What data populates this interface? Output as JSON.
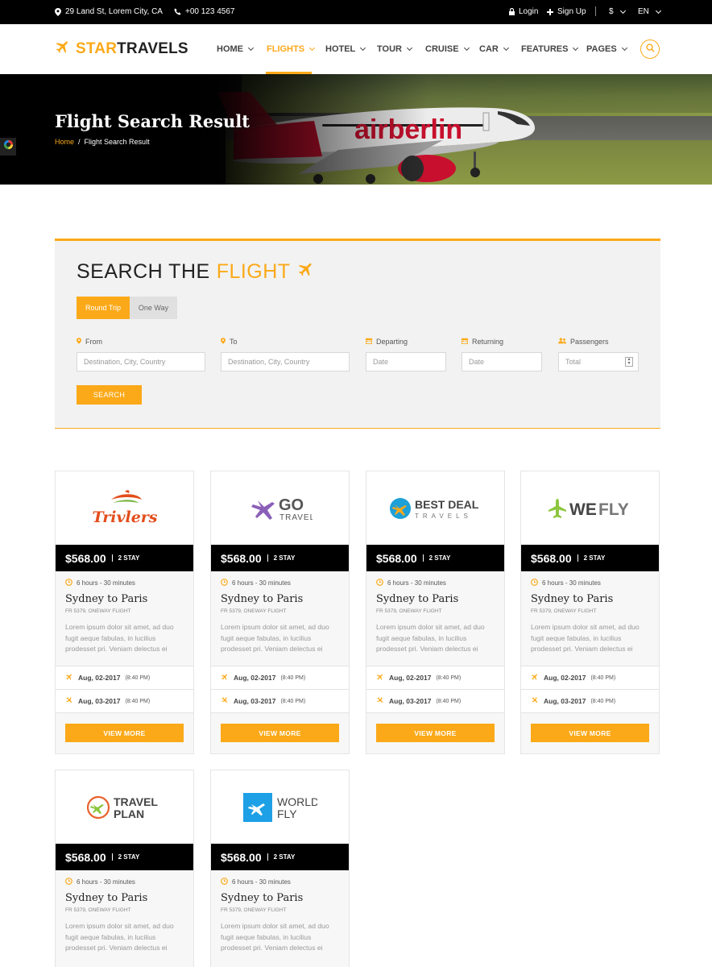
{
  "colors": {
    "accent": "#fba919",
    "dark": "#000000",
    "panel": "#f2f2f2"
  },
  "topbar": {
    "address": "29 Land St, Lorem City, CA",
    "phone": "+00 123 4567",
    "login": "Login",
    "signup": "Sign Up",
    "currency": "$",
    "language": "EN"
  },
  "header": {
    "logo_accent": "STAR",
    "logo_rest": "TRAVELS",
    "nav": [
      "HOME",
      "FLIGHTS",
      "HOTEL",
      "TOUR",
      "CRUISE",
      "CAR",
      "FEATURES",
      "PAGES"
    ],
    "active_nav": "FLIGHTS"
  },
  "hero": {
    "title": "Flight Search Result",
    "breadcrumb_home": "Home",
    "breadcrumb_current": "Flight Search Result",
    "livery_text": "airberlin"
  },
  "search": {
    "title_prefix": "SEARCH THE",
    "title_highlight": "FLIGHT",
    "tabs": [
      "Round Trip",
      "One Way"
    ],
    "active_tab": "Round Trip",
    "fields": [
      {
        "label": "From",
        "placeholder": "Destination, City, Country",
        "icon": "map-pin-icon"
      },
      {
        "label": "To",
        "placeholder": "Destination, City, Country",
        "icon": "map-pin-icon"
      },
      {
        "label": "Departing",
        "placeholder": "Date",
        "icon": "calendar-icon"
      },
      {
        "label": "Returning",
        "placeholder": "Date",
        "icon": "calendar-icon"
      },
      {
        "label": "Passengers",
        "placeholder": "Total",
        "icon": "users-icon"
      }
    ],
    "button": "SEARCH"
  },
  "flights": [
    {
      "brand": "Trivlers",
      "brand_line1": "Trivlers",
      "brand_line2": "",
      "price": "$568.00",
      "stay": "2 STAY",
      "duration": "6 hours - 30 minutes",
      "route": "Sydney to Paris",
      "flight_no": "FR 5379, ONEWAY FLIGHT",
      "description": "Lorem ipsum dolor sit amet, ad duo fugit aeque fabulas, in lucilius prodesset pri. Veniam delectus ei",
      "depart_date": "Aug, 02-2017",
      "depart_time": "(8:40 PM)",
      "arrive_date": "Aug, 03-2017",
      "arrive_time": "(8:40 PM)",
      "button": "VIEW MORE"
    },
    {
      "brand": "GO TRAVEL",
      "brand_line1": "GO",
      "brand_line2": "TRAVEL",
      "price": "$568.00",
      "stay": "2 STAY",
      "duration": "6 hours - 30 minutes",
      "route": "Sydney to Paris",
      "flight_no": "FR 5379, ONEWAY FLIGHT",
      "description": "Lorem ipsum dolor sit amet, ad duo fugit aeque fabulas, in lucilius prodesset pri. Veniam delectus ei",
      "depart_date": "Aug, 02-2017",
      "depart_time": "(8:40 PM)",
      "arrive_date": "Aug, 03-2017",
      "arrive_time": "(8:40 PM)",
      "button": "VIEW MORE"
    },
    {
      "brand": "BEST DEAL TRAVELS",
      "brand_line1": "BEST DEAL",
      "brand_line2": "TRAVELS",
      "price": "$568.00",
      "stay": "2 STAY",
      "duration": "6 hours - 30 minutes",
      "route": "Sydney to Paris",
      "flight_no": "FR 5379, ONEWAY FLIGHT",
      "description": "Lorem ipsum dolor sit amet, ad duo fugit aeque fabulas, in lucilius prodesset pri. Veniam delectus ei",
      "depart_date": "Aug, 02-2017",
      "depart_time": "(8:40 PM)",
      "arrive_date": "Aug, 03-2017",
      "arrive_time": "(8:40 PM)",
      "button": "VIEW MORE"
    },
    {
      "brand": "WEFLY",
      "brand_line1": "WE",
      "brand_line2": "FLY",
      "price": "$568.00",
      "stay": "2 STAY",
      "duration": "6 hours - 30 minutes",
      "route": "Sydney to Paris",
      "flight_no": "FR 5379, ONEWAY FLIGHT",
      "description": "Lorem ipsum dolor sit amet, ad duo fugit aeque fabulas, in lucilius prodesset pri. Veniam delectus ei",
      "depart_date": "Aug, 02-2017",
      "depart_time": "(8:40 PM)",
      "arrive_date": "Aug, 03-2017",
      "arrive_time": "(8:40 PM)",
      "button": "VIEW MORE"
    },
    {
      "brand": "TRAVEL PLAN",
      "brand_line1": "TRAVEL",
      "brand_line2": "PLAN",
      "price": "$568.00",
      "stay": "2 STAY",
      "duration": "6 hours - 30 minutes",
      "route": "Sydney to Paris",
      "flight_no": "FR 5379, ONEWAY FLIGHT",
      "description": "Lorem ipsum dolor sit amet, ad duo fugit aeque fabulas, in lucilius prodesset pri. Veniam delectus ei"
    },
    {
      "brand": "WORLD FLY",
      "brand_line1": "WORLD",
      "brand_line2": "FLY",
      "price": "$568.00",
      "stay": "2 STAY",
      "duration": "6 hours - 30 minutes",
      "route": "Sydney to Paris",
      "flight_no": "FR 5379, ONEWAY FLIGHT",
      "description": "Lorem ipsum dolor sit amet, ad duo fugit aeque fabulas, in lucilius prodesset pri. Veniam delectus ei"
    }
  ]
}
